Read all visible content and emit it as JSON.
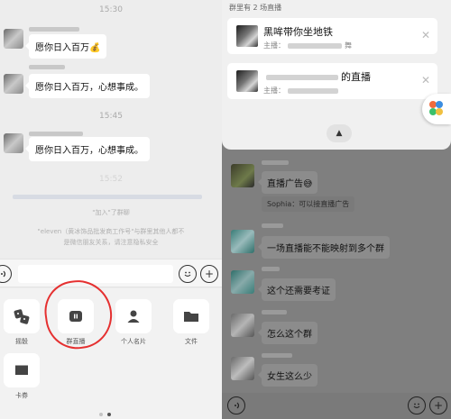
{
  "left": {
    "times": [
      "15:30",
      "15:45",
      "15:52"
    ],
    "messages": [
      {
        "text": "愿你日入百万💰"
      },
      {
        "text": "愿你日入百万，心想事成。"
      },
      {
        "text": "愿你日入百万，心想事成。"
      }
    ],
    "system_notice": {
      "join": "\"加入\"了群聊",
      "line1": "\"eleven（黄冰饰品批发商工作号\"与群里其他人都不",
      "line2": "是微信朋友关系，请注意隐私安全"
    },
    "input": {
      "voice_icon": "voice-icon",
      "emoji_icon": "emoji-icon",
      "plus_icon": "plus-icon"
    },
    "tools": [
      {
        "label": "摇骰",
        "icon": "dice-icon"
      },
      {
        "label": "群直播",
        "icon": "live-icon"
      },
      {
        "label": "个人名片",
        "icon": "contact-card-icon"
      },
      {
        "label": "文件",
        "icon": "folder-icon"
      },
      {
        "label": "卡券",
        "icon": "coupon-icon"
      }
    ],
    "highlight_color": "#e53030"
  },
  "right": {
    "sheet_title": "群里有 2 场直播",
    "live_cards": [
      {
        "title": "黑哞带你坐地铁",
        "host_prefix": "主播：",
        "host_suffix": "舞"
      },
      {
        "title": "的直播",
        "host_prefix": "主播：",
        "host_suffix": ""
      }
    ],
    "collapse_icon": "chevron-up-icon",
    "messages": [
      {
        "text": "直播广告😅",
        "quote": "Sophia：可以接直播广告"
      },
      {
        "text": "一场直播能不能映射到多个群"
      },
      {
        "text": "这个还需要考证"
      },
      {
        "text": "怎么这个群"
      },
      {
        "text": "女生这么少"
      }
    ]
  }
}
